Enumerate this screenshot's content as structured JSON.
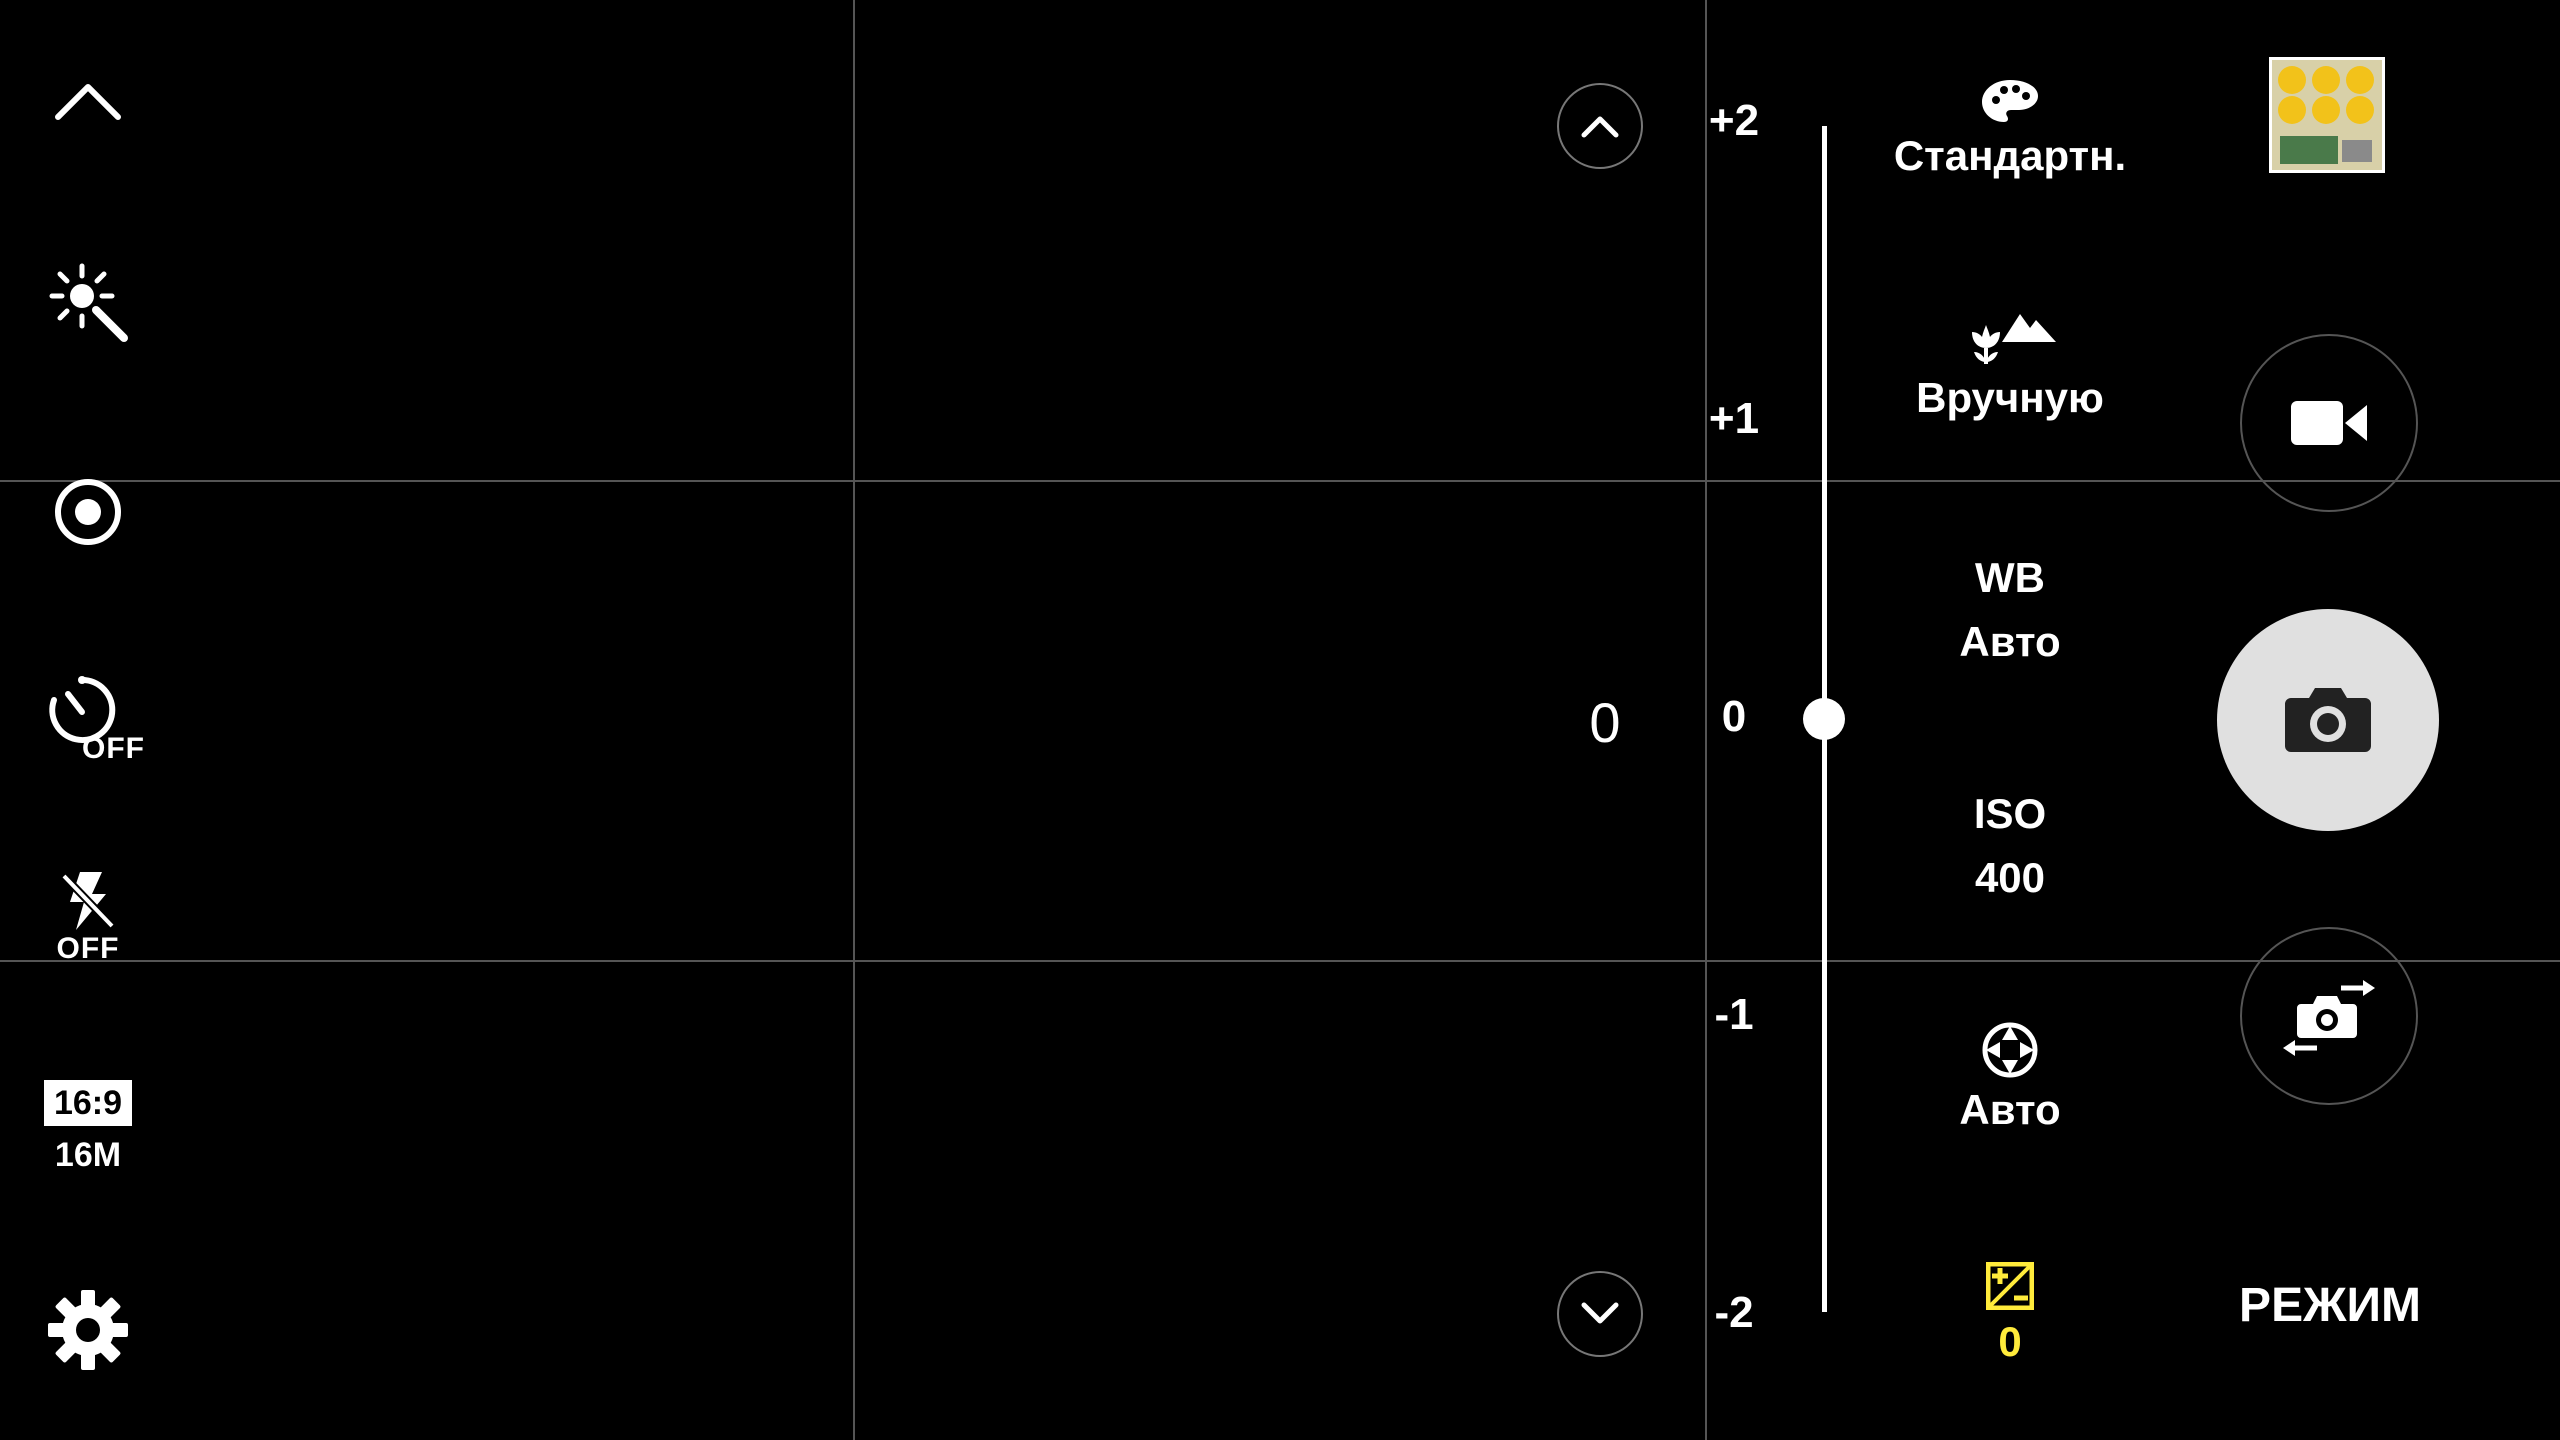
{
  "left_toolbar": {
    "timer_state": "OFF",
    "flash_state": "OFF",
    "ratio": "16:9",
    "resolution": "16M"
  },
  "exposure": {
    "current_value": "0",
    "scale_labels": [
      "+2",
      "+1",
      "0",
      "-1",
      "-2"
    ],
    "level": 0
  },
  "settings": {
    "color_tone": "Стандартн.",
    "focus": "Вручную",
    "wb_title": "WB",
    "wb_value": "Авто",
    "iso_title": "ISO",
    "iso_value": "400",
    "metering": "Авто",
    "exposure_value": "0"
  },
  "mode_label": "РЕЖИМ",
  "colors": {
    "accent_yellow": "#ffeb3b",
    "shutter_bg": "#e0e0e0"
  }
}
